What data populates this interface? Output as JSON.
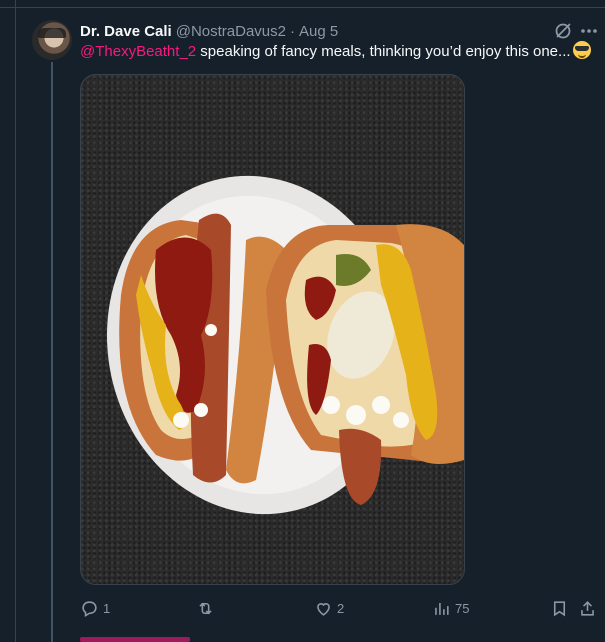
{
  "tweet": {
    "author_name": "Dr. Dave Cali",
    "author_handle": "@NostraDavus2",
    "separator": "·",
    "date": "Aug 5",
    "mention": "@ThexyBeatht_2",
    "text": " speaking of fancy meals, thinking you’d enjoy this one...",
    "emoji": "smiling-face-with-sunglasses",
    "media_alt": "Two hot dogs in toasted buns with ketchup, mustard, relish and onions on a white plate"
  },
  "actions": {
    "reply_count": "1",
    "retweet_count": "",
    "like_count": "2",
    "view_count": "75"
  },
  "colors": {
    "background": "#15202b",
    "mention": "#f91880",
    "muted": "#8b98a5",
    "border": "#38444d"
  }
}
